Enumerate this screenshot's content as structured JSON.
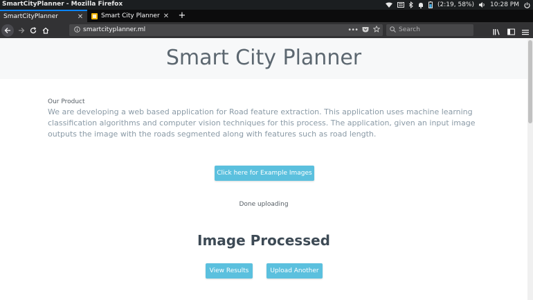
{
  "os": {
    "window_title": "SmartCityPlanner - Mozilla Firefox",
    "battery": "(2:19, 58%)",
    "time": "10:28 PM"
  },
  "tabs": [
    {
      "label": "SmartCityPlanner",
      "active": true
    },
    {
      "label": "Smart City Planner upd",
      "active": false
    }
  ],
  "nav": {
    "url": "smartcityplanner.ml",
    "search_placeholder": "Search"
  },
  "page": {
    "title": "Smart City Planner",
    "product_label": "Our Product",
    "product_description": "We are developing a web based application for Road feature extraction. This application uses machine learning classification algorithms and computer vision techniques for this process. The application, given an input image outputs the image with the roads segmented along with features such as road length.",
    "examples_button": "Click here for Example Images",
    "status": "Done uploading",
    "processed_heading": "Image Processed",
    "view_results_button": "View Results",
    "upload_another_button": "Upload Another"
  },
  "colors": {
    "accent": "#0a84ff",
    "button": "#5bc0de",
    "jumbotron": "#f7f8f9"
  }
}
